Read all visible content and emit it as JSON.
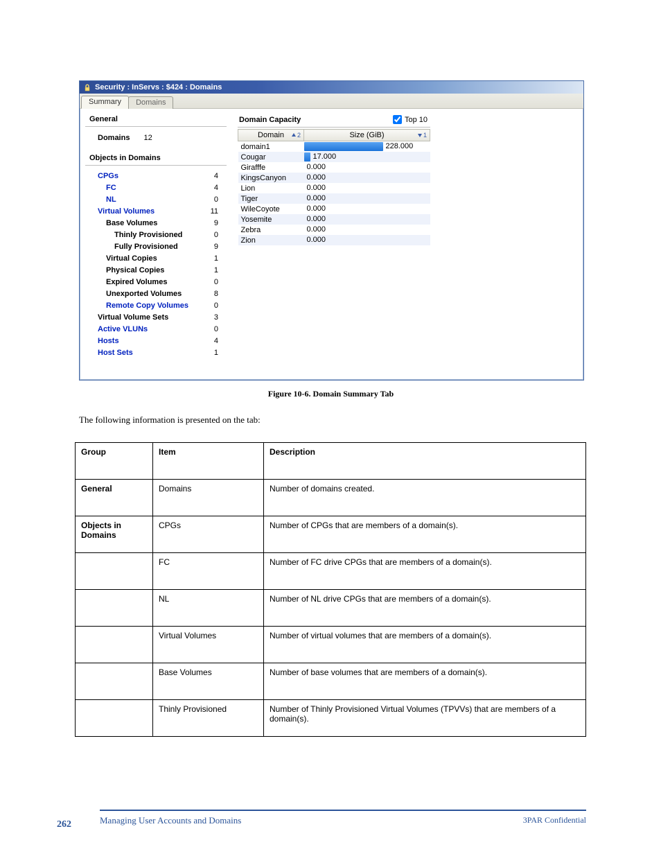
{
  "titlebar": {
    "icon": "lock-icon",
    "text": "Security : InServs : $424 : Domains"
  },
  "tabs": {
    "summary": "Summary",
    "domains": "Domains"
  },
  "left": {
    "general": "General",
    "domains_label": "Domains",
    "domains_count": "12",
    "objects_title": "Objects in Domains",
    "tree": [
      {
        "label": "CPGs",
        "value": "4",
        "lvl": 0,
        "link": true
      },
      {
        "label": "FC",
        "value": "4",
        "lvl": 1,
        "link": true
      },
      {
        "label": "NL",
        "value": "0",
        "lvl": 1,
        "link": true
      },
      {
        "label": "Virtual Volumes",
        "value": "11",
        "lvl": 0,
        "link": true
      },
      {
        "label": "Base Volumes",
        "value": "9",
        "lvl": 1,
        "link": false
      },
      {
        "label": "Thinly Provisioned",
        "value": "0",
        "lvl": 2,
        "link": false
      },
      {
        "label": "Fully Provisioned",
        "value": "9",
        "lvl": 2,
        "link": false
      },
      {
        "label": "Virtual Copies",
        "value": "1",
        "lvl": 1,
        "link": false
      },
      {
        "label": "Physical Copies",
        "value": "1",
        "lvl": 1,
        "link": false
      },
      {
        "label": "Expired Volumes",
        "value": "0",
        "lvl": 1,
        "link": false
      },
      {
        "label": "Unexported Volumes",
        "value": "8",
        "lvl": 1,
        "link": false
      },
      {
        "label": "Remote Copy Volumes",
        "value": "0",
        "lvl": 1,
        "link": true
      },
      {
        "label": "Virtual Volume Sets",
        "value": "3",
        "lvl": 0,
        "link": false
      },
      {
        "label": "Active VLUNs",
        "value": "0",
        "lvl": 0,
        "link": true
      },
      {
        "label": "Hosts",
        "value": "4",
        "lvl": 0,
        "link": true
      },
      {
        "label": "Host Sets",
        "value": "1",
        "lvl": 0,
        "link": true
      }
    ]
  },
  "capacity": {
    "title": "Domain Capacity",
    "top10": "Top 10",
    "col_domain": "Domain",
    "col_size": "Size (GiB)",
    "sort_domain": "2",
    "sort_size": "1",
    "max": 228.0,
    "rows": [
      {
        "name": "domain1",
        "value": 228.0,
        "label": "228.000",
        "pos": "out"
      },
      {
        "name": "Cougar",
        "value": 17.0,
        "label": "17.000",
        "pos": "out"
      },
      {
        "name": "Girafffe",
        "value": 0.0,
        "label": "0.000",
        "pos": "out"
      },
      {
        "name": "KingsCanyon",
        "value": 0.0,
        "label": "0.000",
        "pos": "out"
      },
      {
        "name": "Lion",
        "value": 0.0,
        "label": "0.000",
        "pos": "out"
      },
      {
        "name": "Tiger",
        "value": 0.0,
        "label": "0.000",
        "pos": "out"
      },
      {
        "name": "WileCoyote",
        "value": 0.0,
        "label": "0.000",
        "pos": "out"
      },
      {
        "name": "Yosemite",
        "value": 0.0,
        "label": "0.000",
        "pos": "out"
      },
      {
        "name": "Zebra",
        "value": 0.0,
        "label": "0.000",
        "pos": "out"
      },
      {
        "name": "Zion",
        "value": 0.0,
        "label": "0.000",
        "pos": "out"
      }
    ]
  },
  "chart_data": {
    "type": "bar",
    "orientation": "horizontal",
    "title": "Domain Capacity",
    "xlabel": "Size (GiB)",
    "ylabel": "Domain",
    "categories": [
      "domain1",
      "Cougar",
      "Girafffe",
      "KingsCanyon",
      "Lion",
      "Tiger",
      "WileCoyote",
      "Yosemite",
      "Zebra",
      "Zion"
    ],
    "values": [
      228.0,
      17.0,
      0.0,
      0.0,
      0.0,
      0.0,
      0.0,
      0.0,
      0.0,
      0.0
    ],
    "xlim": [
      0,
      228
    ]
  },
  "doc_caption": "Figure 10-6.  Domain Summary Tab",
  "doc_intro": "The following information is presented on the tab:",
  "doc_table": {
    "header": [
      "Group",
      "Item",
      "Description"
    ],
    "rows": [
      [
        "General",
        "Domains",
        "Number of domains created."
      ],
      [
        "Objects in Domains",
        "CPGs",
        "Number of CPGs that are members of a domain(s)."
      ],
      [
        "",
        "FC",
        "Number of FC drive CPGs that are members of a domain(s)."
      ],
      [
        "",
        "NL",
        "Number of NL drive CPGs that are members of a domain(s)."
      ],
      [
        "",
        "Virtual Volumes",
        "Number of virtual volumes that are members of a domain(s)."
      ],
      [
        "",
        "Base Volumes",
        "Number of base volumes that are members of a domain(s)."
      ],
      [
        "",
        "Thinly Provisioned",
        "Number of Thinly Provisioned Virtual Volumes (TPVVs) that are members of a domain(s)."
      ]
    ]
  },
  "page_number": "262",
  "page_footer": "Managing User Accounts and Domains"
}
